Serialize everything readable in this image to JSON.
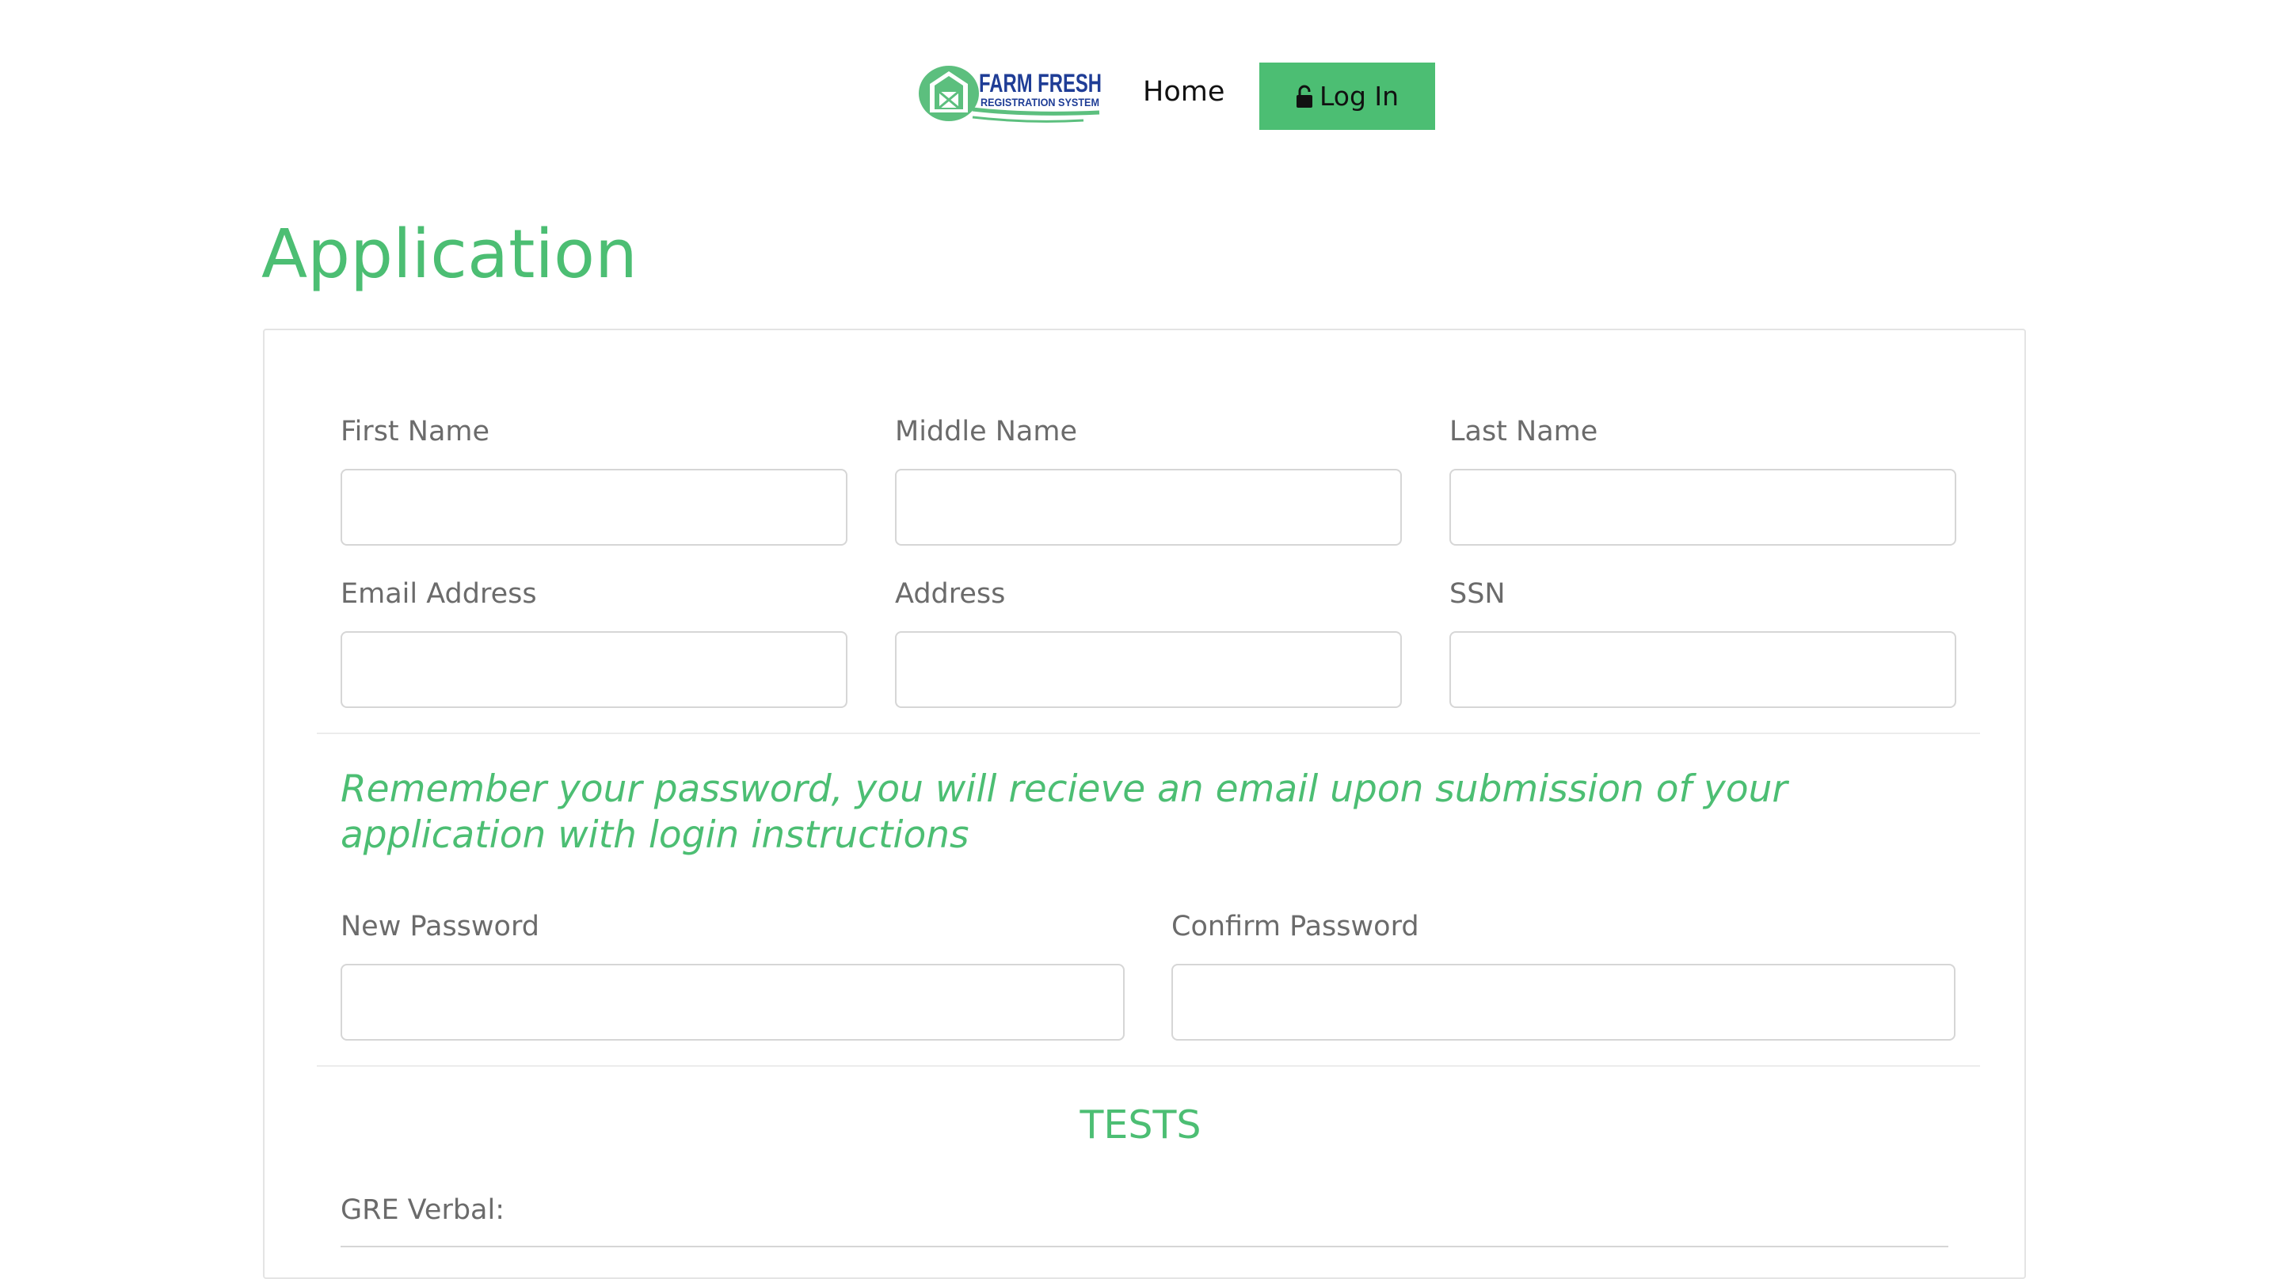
{
  "nav": {
    "logo_text": "FARM FRESH",
    "logo_subtext": "REGISTRATION SYSTEM",
    "home_label": "Home",
    "login_label": "Log In"
  },
  "page": {
    "title": "Application"
  },
  "form": {
    "personal_fields": [
      {
        "label": "First Name",
        "value": ""
      },
      {
        "label": "Middle Name",
        "value": ""
      },
      {
        "label": "Last Name",
        "value": ""
      },
      {
        "label": "Email Address",
        "value": ""
      },
      {
        "label": "Address",
        "value": ""
      },
      {
        "label": "SSN",
        "value": ""
      }
    ],
    "notice": "Remember your password, you will recieve an email upon submission of your application with login instructions",
    "password_fields": [
      {
        "label": "New Password",
        "value": ""
      },
      {
        "label": "Confirm Password",
        "value": ""
      }
    ],
    "tests_heading": "TESTS",
    "gre_verbal_label": "GRE Verbal:"
  },
  "colors": {
    "accent": "#4cbe73",
    "logo_blue": "#1f3d96",
    "text_muted": "#6b6b6b"
  }
}
